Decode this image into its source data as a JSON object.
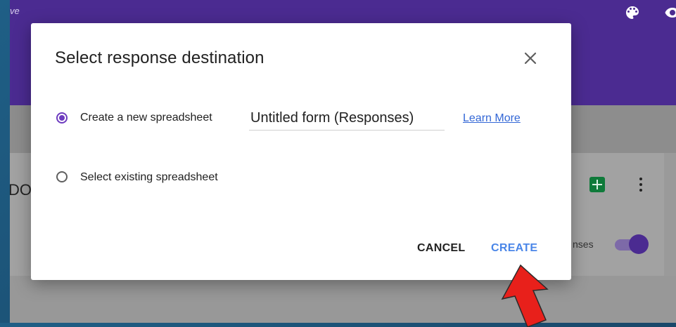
{
  "background_app": {
    "topbar_text": "ve",
    "card_title": "DO",
    "responses_text": "nses",
    "accent_color": "#4b2b91"
  },
  "dialog": {
    "title": "Select response destination",
    "close_icon": "close-icon",
    "options": [
      {
        "label": "Create a new spreadsheet",
        "checked": true
      },
      {
        "label": "Select existing spreadsheet",
        "checked": false
      }
    ],
    "spreadsheet_name": "Untitled form (Responses)",
    "learn_more": "Learn More",
    "cancel_label": "CANCEL",
    "create_label": "CREATE",
    "radio_color": "#6d3bbf",
    "link_color": "#3367d6"
  },
  "annotation": {
    "arrow_color": "#e8201b",
    "icon": "red-arrow-pointer"
  }
}
